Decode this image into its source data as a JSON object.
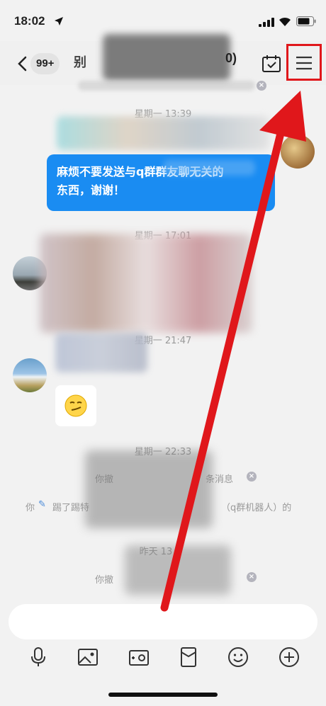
{
  "status_bar": {
    "time": "18:02"
  },
  "nav": {
    "unread_count": "99+",
    "title_fragment": "别",
    "title_tail": "0)"
  },
  "messages": {
    "ts1": "星期一 13:39",
    "outgoing_text_line1": "麻烦不要发送与q群群友聊无关的",
    "outgoing_text_line2": "东西，谢谢！",
    "ts2": "星期一 17:01",
    "ts3": "星期一 21:47",
    "ts4": "星期一 22:33",
    "sys1_prefix": "你撤",
    "sys1_suffix": "条消息",
    "sys2_prefix": "你",
    "sys2_mid": "踢了踢特",
    "sys2_suffix": "（q群机器人）的",
    "ts5": "昨天 13",
    "sys3_prefix": "你撤"
  },
  "colors": {
    "accent_blue": "#1a8cf2",
    "annotation_red": "#e0171b"
  },
  "icons": [
    "location-arrow-icon",
    "signal-icon",
    "wifi-icon",
    "battery-icon",
    "chevron-left-icon",
    "calendar-check-icon",
    "menu-icon",
    "mic-icon",
    "image-icon",
    "camera-icon",
    "red-packet-icon",
    "emoji-icon",
    "plus-icon"
  ]
}
